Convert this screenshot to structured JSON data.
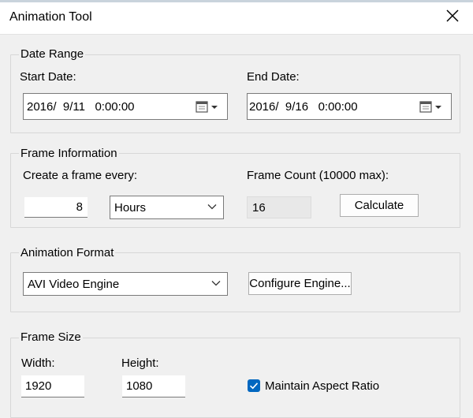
{
  "window": {
    "title": "Animation Tool"
  },
  "date_range": {
    "legend": "Date Range",
    "start_label": "Start Date:",
    "start_value": "2016/  9/11   0:00:00",
    "end_label": "End Date:",
    "end_value": "2016/  9/16   0:00:00"
  },
  "frame_info": {
    "legend": "Frame Information",
    "create_label": "Create a frame every:",
    "interval_value": "8",
    "unit_value": "Hours",
    "count_label": "Frame Count (10000 max):",
    "count_value": "16",
    "calculate_label": "Calculate"
  },
  "animation_format": {
    "legend": "Animation Format",
    "engine_value": "AVI Video Engine",
    "configure_label": "Configure Engine..."
  },
  "frame_size": {
    "legend": "Frame Size",
    "width_label": "Width:",
    "width_value": "1920",
    "height_label": "Height:",
    "height_value": "1080",
    "aspect_label": "Maintain Aspect Ratio",
    "aspect_checked": true
  },
  "colors": {
    "accent": "#0067c0",
    "background": "#f0f0f0"
  },
  "icons": [
    "close-icon",
    "calendar-icon",
    "chevron-down-icon",
    "checkmark-icon"
  ]
}
